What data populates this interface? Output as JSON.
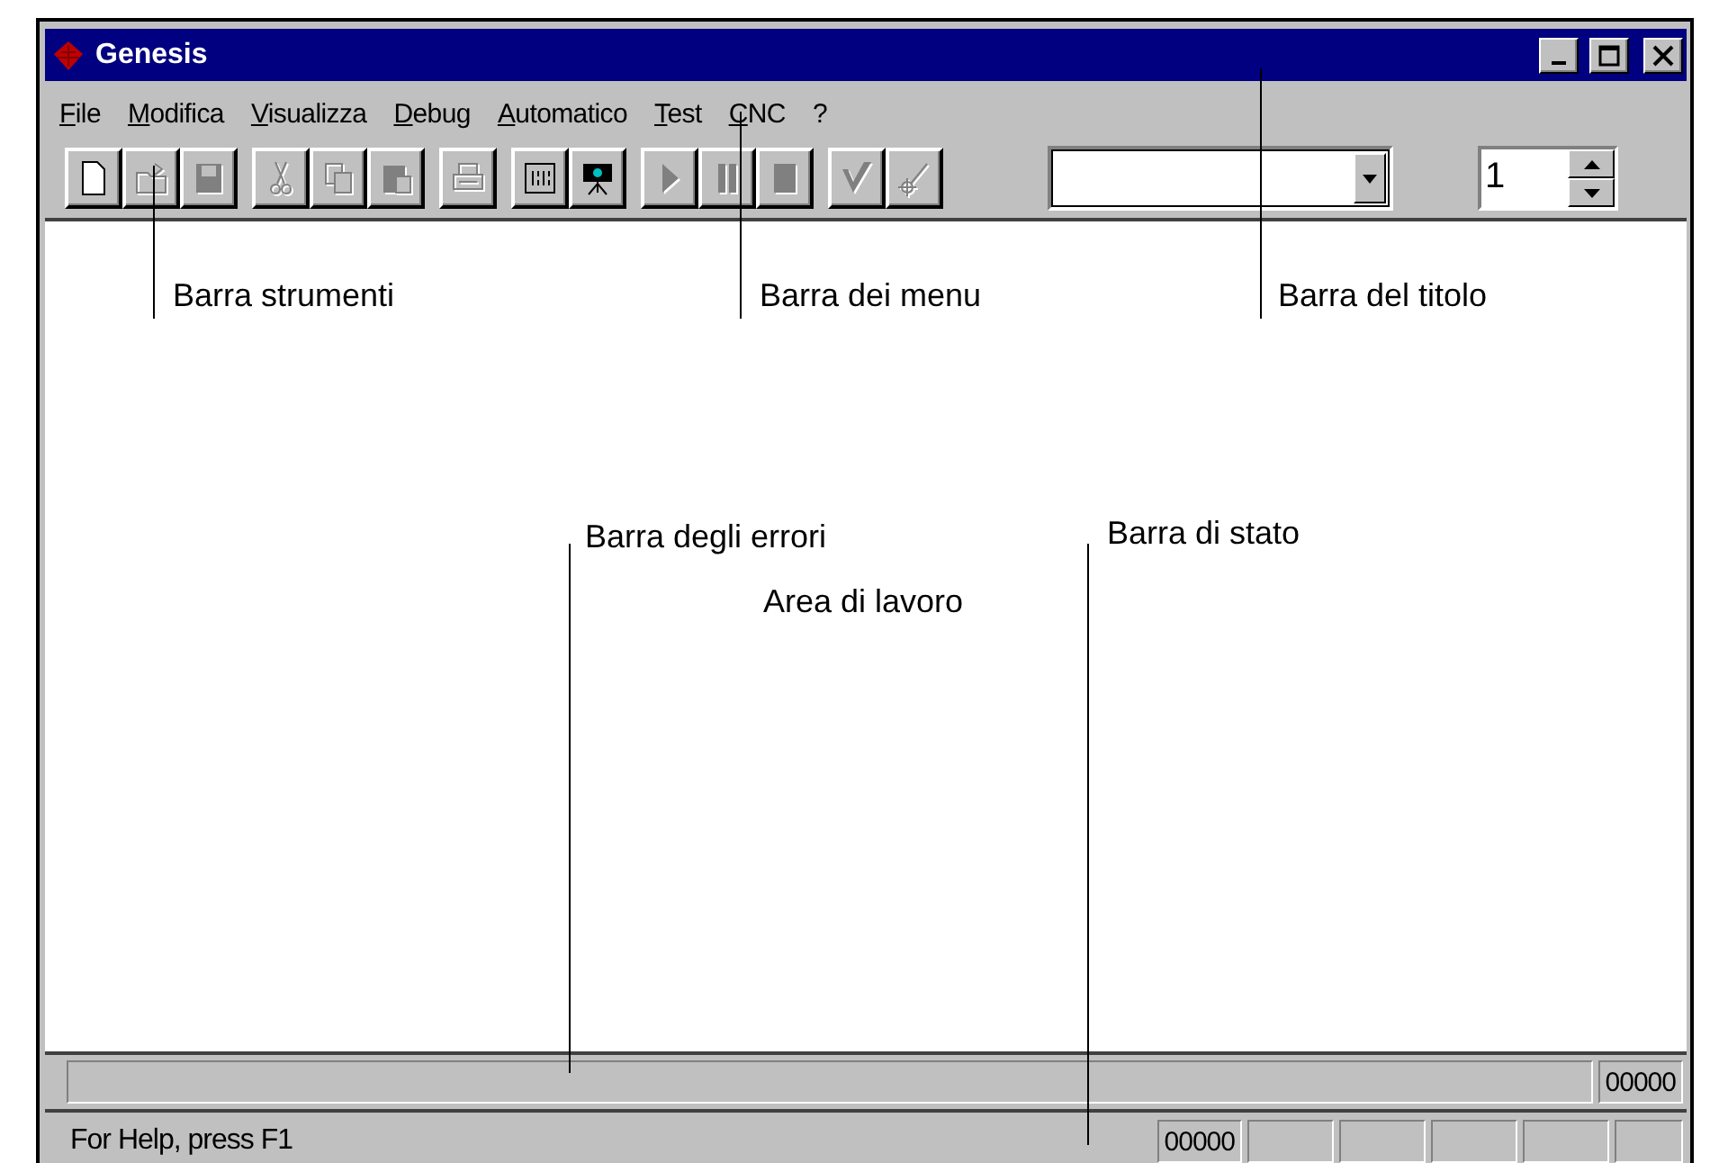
{
  "window": {
    "title": "Genesis"
  },
  "menu": [
    "File",
    "Modifica",
    "Visualizza",
    "Debug",
    "Automatico",
    "Test",
    "CNC",
    "?"
  ],
  "toolbar": {
    "groups": [
      [
        {
          "kind": "new",
          "disabled": false
        },
        {
          "kind": "open",
          "disabled": true
        },
        {
          "kind": "save",
          "disabled": true
        }
      ],
      [
        {
          "kind": "cut",
          "disabled": true
        },
        {
          "kind": "copy",
          "disabled": true
        },
        {
          "kind": "paste",
          "disabled": true
        }
      ],
      [
        {
          "kind": "print",
          "disabled": true
        }
      ],
      [
        {
          "kind": "grid",
          "disabled": false
        },
        {
          "kind": "camera",
          "disabled": false
        }
      ],
      [
        {
          "kind": "play",
          "disabled": true
        },
        {
          "kind": "pause",
          "disabled": true
        },
        {
          "kind": "stop",
          "disabled": true
        }
      ],
      [
        {
          "kind": "check",
          "disabled": true
        },
        {
          "kind": "target",
          "disabled": true
        }
      ]
    ],
    "spin_value": "1"
  },
  "error_bar": {
    "counter": "00000"
  },
  "status_bar": {
    "message": "For Help, press F1",
    "counter": "00000"
  },
  "annotations": [
    {
      "label": "Barra strumenti"
    },
    {
      "label": "Barra dei menu"
    },
    {
      "label": "Barra del titolo"
    },
    {
      "label": "Area di lavoro"
    },
    {
      "label": "Barra degli errori"
    },
    {
      "label": "Barra di stato"
    }
  ]
}
